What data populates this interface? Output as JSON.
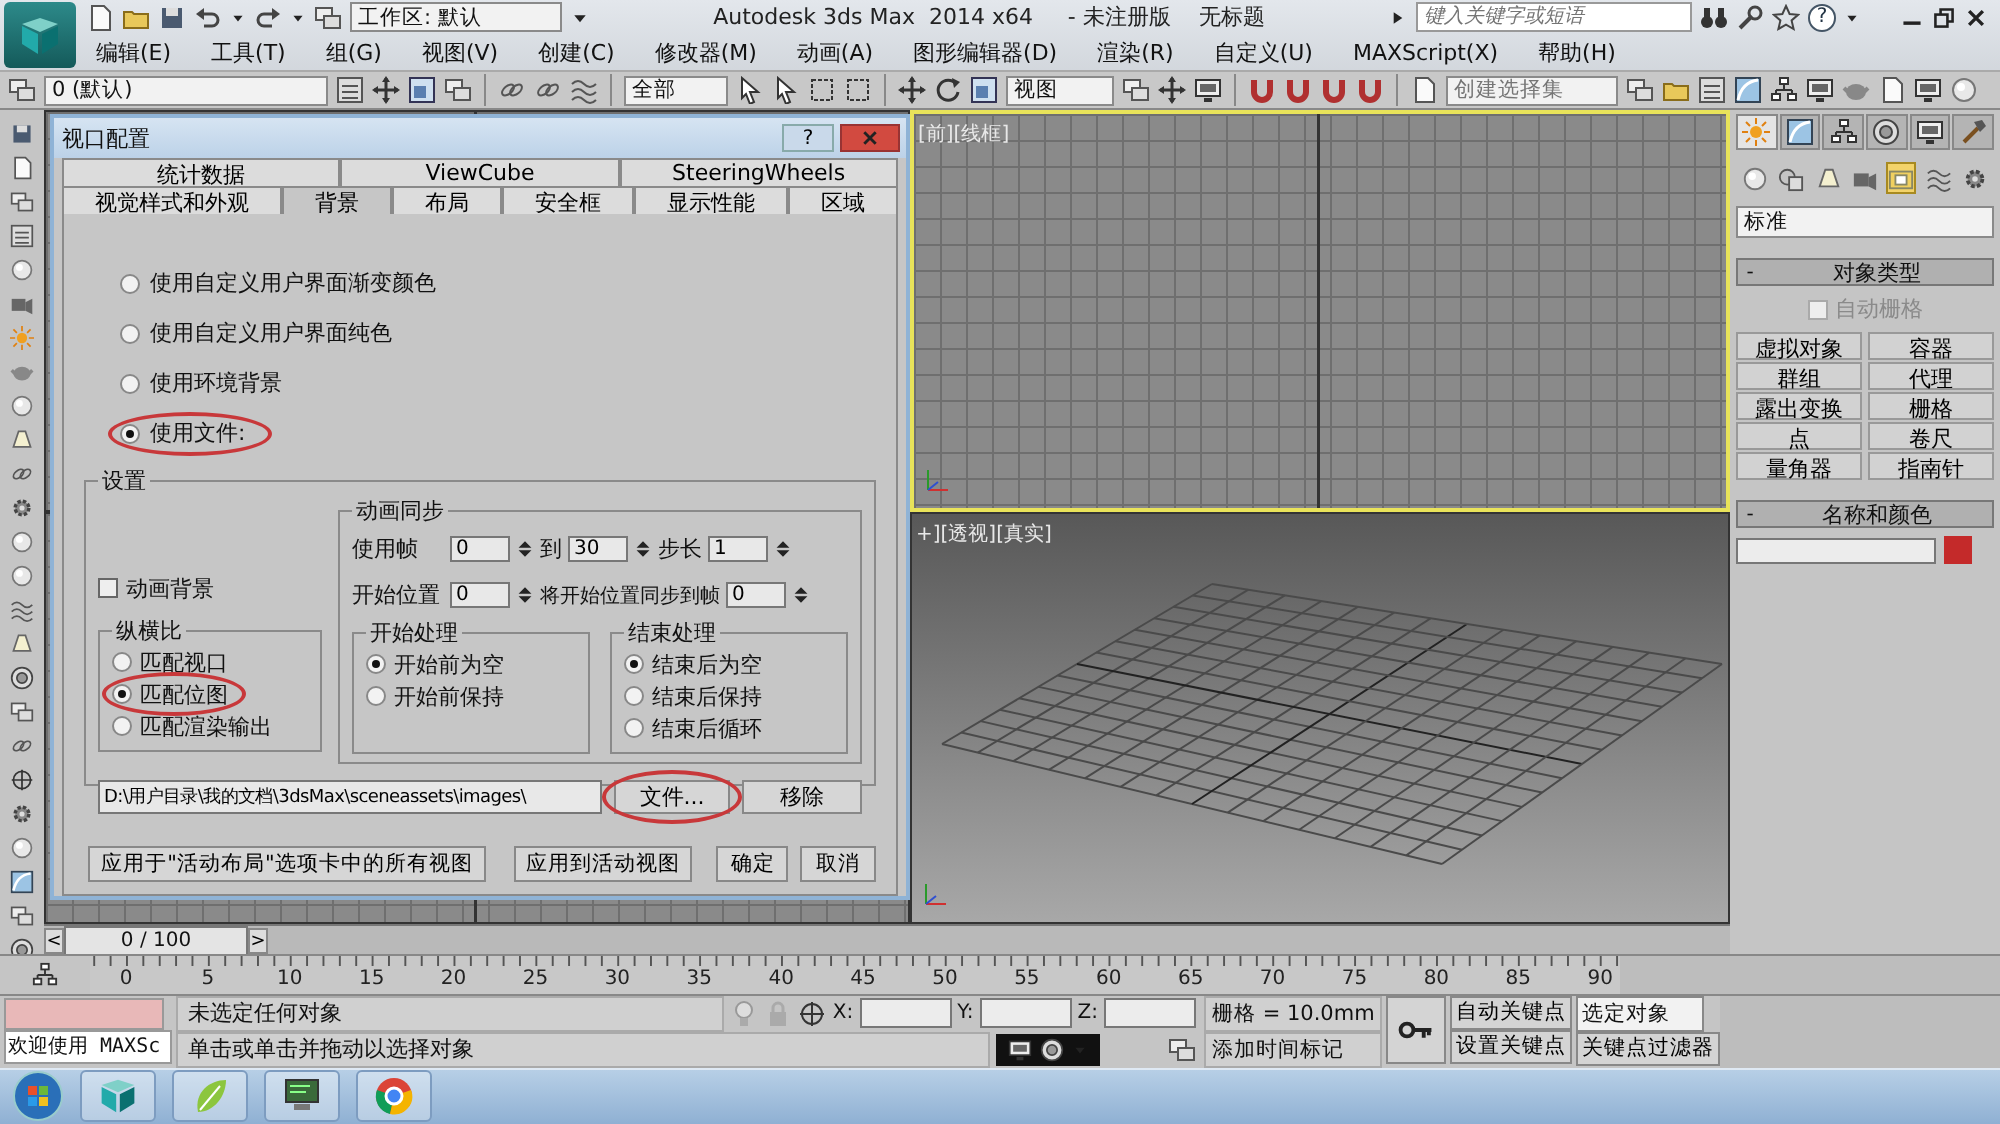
{
  "title_bar": {
    "workspace": "工作区: 默认",
    "title": "Autodesk 3ds Max  2014 x64     - 未注册版    无标题",
    "search_placeholder": "键入关键字或短语",
    "help": "?"
  },
  "menu": [
    "编辑(E)",
    "工具(T)",
    "组(G)",
    "视图(V)",
    "创建(C)",
    "修改器(M)",
    "动画(A)",
    "图形编辑器(D)",
    "渲染(R)",
    "自定义(U)",
    "MAXScript(X)",
    "帮助(H)"
  ],
  "toolbar": {
    "layer": "0 (默认)",
    "selection_filter": "全部",
    "coordinate_system": "视图",
    "selection_set_placeholder": "创建选择集"
  },
  "viewports": [
    {
      "kind": "ortho",
      "active": false
    },
    {
      "kind": "ortho",
      "active": true,
      "label": "[前][线框]"
    },
    {
      "kind": "ortho",
      "active": false
    },
    {
      "kind": "perspective",
      "active": false,
      "label": "+][透视][真实]"
    }
  ],
  "dialog": {
    "title": "视口配置",
    "help": "?",
    "tab_rows": [
      [
        {
          "label": "统计数据",
          "selected": false
        },
        {
          "label": "ViewCube",
          "selected": false
        },
        {
          "label": "SteeringWheels",
          "selected": false
        }
      ],
      [
        {
          "label": "视觉样式和外观",
          "selected": false
        },
        {
          "label": "背景",
          "selected": true
        },
        {
          "label": "布局",
          "selected": false
        },
        {
          "label": "安全框",
          "selected": false
        },
        {
          "label": "显示性能",
          "selected": false
        },
        {
          "label": "区域",
          "selected": false
        }
      ]
    ],
    "background_options": [
      {
        "label": "使用自定义用户界面渐变颜色",
        "selected": false,
        "circled": false
      },
      {
        "label": "使用自定义用户界面纯色",
        "selected": false,
        "circled": false
      },
      {
        "label": "使用环境背景",
        "selected": false,
        "circled": false
      },
      {
        "label": "使用文件:",
        "selected": true,
        "circled": true
      }
    ],
    "settings": {
      "title": "设置",
      "animate_background": {
        "label": "动画背景",
        "checked": false
      },
      "aspect": {
        "title": "纵横比",
        "options": [
          {
            "label": "匹配视口",
            "selected": false,
            "circled": false
          },
          {
            "label": "匹配位图",
            "selected": true,
            "circled": true
          },
          {
            "label": "匹配渲染输出",
            "selected": false,
            "circled": false
          }
        ]
      },
      "sync": {
        "title": "动画同步",
        "use_frame_label": "使用帧",
        "use_frame_from": "0",
        "to_label": "到",
        "use_frame_to": "30",
        "step_label": "步长",
        "step": "1",
        "start_label": "开始位置",
        "start": "0",
        "sync_label": "将开始位置同步到帧",
        "sync_frame": "0",
        "start_processing": {
          "title": "开始处理",
          "options": [
            {
              "label": "开始前为空",
              "selected": true
            },
            {
              "label": "开始前保持",
              "selected": false
            }
          ]
        },
        "end_processing": {
          "title": "结束处理",
          "options": [
            {
              "label": "结束后为空",
              "selected": true
            },
            {
              "label": "结束后保持",
              "selected": false
            },
            {
              "label": "结束后循环",
              "selected": false
            }
          ]
        }
      },
      "path": "D:\\用户目录\\我的文档\\3dsMax\\sceneassets\\images\\",
      "file_button": {
        "label": "文件...",
        "circled": true
      },
      "remove_button": "移除"
    },
    "footer_buttons": [
      "应用于\"活动布局\"选项卡中的所有视图",
      "应用到活动视图",
      "确定",
      "取消"
    ]
  },
  "command_panel": {
    "tabs": [
      {
        "selected": true
      },
      {
        "selected": false
      },
      {
        "selected": false
      },
      {
        "selected": false
      },
      {
        "selected": false
      },
      {
        "selected": false
      }
    ],
    "subcategories": [
      {
        "selected": false
      },
      {
        "selected": false
      },
      {
        "selected": false
      },
      {
        "selected": false
      },
      {
        "selected": true
      },
      {
        "selected": false
      },
      {
        "selected": false
      }
    ],
    "category": "标准",
    "object_type": {
      "collapse": "-",
      "title": "对象类型",
      "auto_grid": {
        "label": "自动栅格",
        "checked": false,
        "disabled": true
      },
      "buttons": [
        "虚拟对象",
        "容器",
        "群组",
        "代理",
        "露出变换",
        "栅格",
        "点",
        "卷尺",
        "量角器",
        "指南针"
      ]
    },
    "name_color": {
      "collapse": "-",
      "title": "名称和颜色",
      "color": "#c42a2a"
    }
  },
  "timeline": {
    "prev": "<",
    "slider": "0 / 100",
    "level": 0,
    "next": ">",
    "ticks": [
      "0",
      "5",
      "10",
      "15",
      "20",
      "25",
      "30",
      "35",
      "40",
      "45",
      "50",
      "55",
      "60",
      "65",
      "70",
      "75",
      "80",
      "85",
      "90"
    ]
  },
  "status": {
    "maxscript": "欢迎使用 MAXSc",
    "selection": "未选定任何对象",
    "prompt": "单击或单击并拖动以选择对象",
    "x_label": "X:",
    "y_label": "Y:",
    "z_label": "Z:",
    "grid": "栅格 = 10.0mm",
    "add_time_tag": "添加时间标记",
    "auto_key": "自动关键点",
    "set_key": "设置关键点",
    "key_mode": "选定对象",
    "key_filters": "关键点过滤器"
  }
}
